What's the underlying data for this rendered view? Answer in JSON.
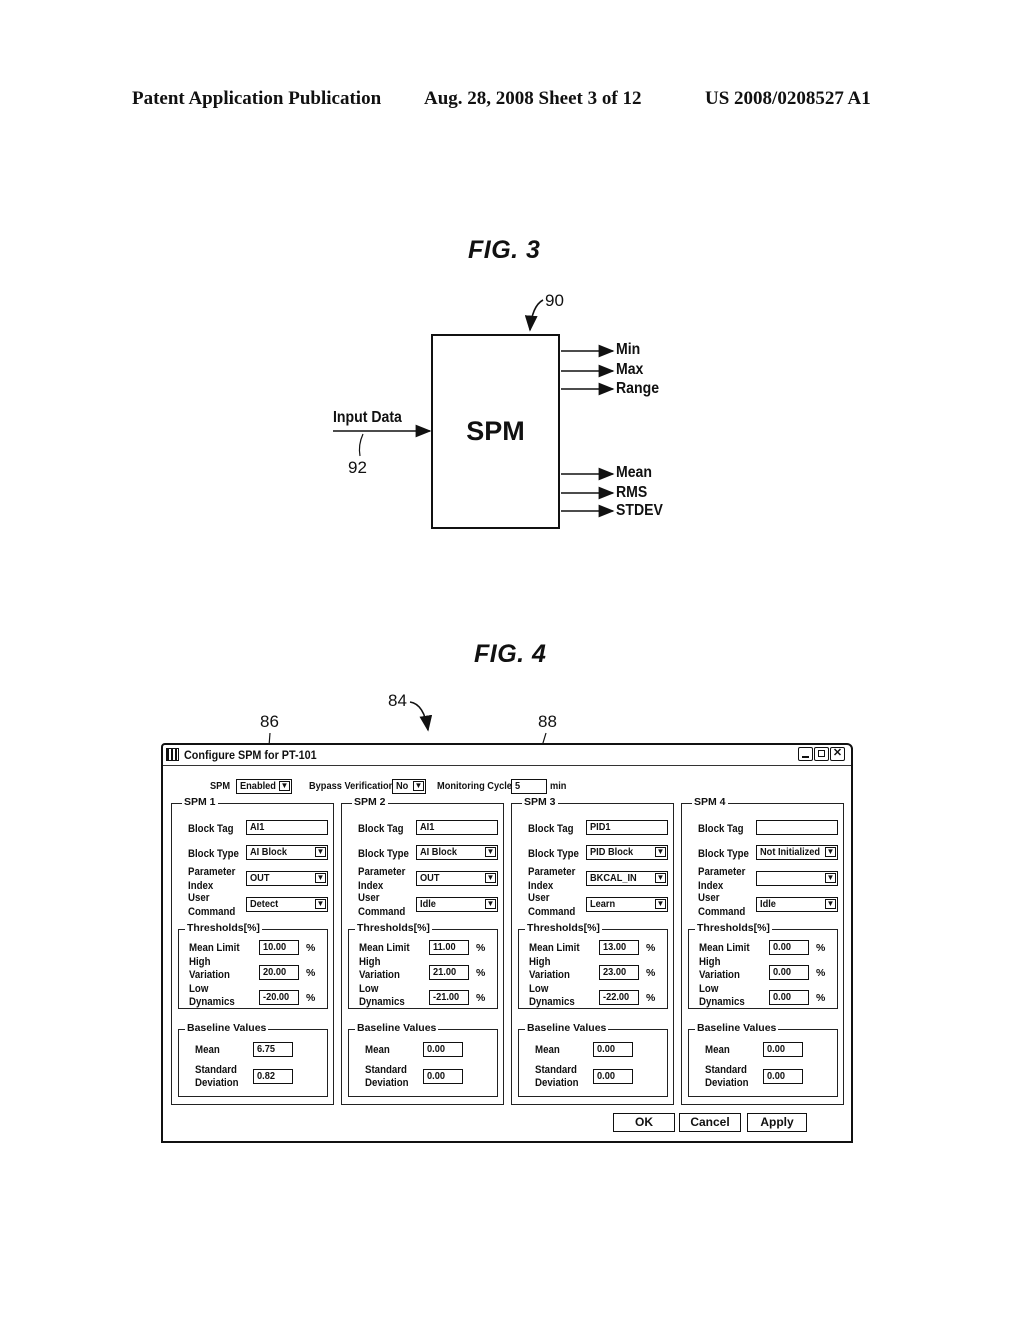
{
  "header": {
    "publication": "Patent Application Publication",
    "date_sheet": "Aug. 28, 2008  Sheet 3 of 12",
    "number": "US 2008/0208527 A1"
  },
  "fig3": {
    "title": "FIG. 3",
    "block_label": "SPM",
    "input_label": "Input Data",
    "ref_block": "90",
    "ref_input": "92",
    "outputs": [
      "Min",
      "Max",
      "Range",
      "Mean",
      "RMS",
      "STDEV"
    ]
  },
  "fig4": {
    "title": "FIG. 4",
    "ref_dialog": "84",
    "ref_spm": "86",
    "ref_cycle": "88",
    "dialog": {
      "title": "Configure SPM for PT-101",
      "icons": {
        "app": "app-icon",
        "minimize": "minimize-icon",
        "maximize": "maximize-icon",
        "close": "close-icon"
      },
      "spm_label": "SPM",
      "spm_value": "Enabled",
      "bypass_label": "Bypass Verification",
      "bypass_value": "No",
      "cycle_label": "Monitoring Cycle",
      "cycle_value": "5",
      "cycle_unit": "min",
      "labels": {
        "block_tag": "Block Tag",
        "block_type": "Block Type",
        "param1": "Parameter",
        "param2": "Index",
        "user1": "User",
        "user2": "Command",
        "thresholds": "Thresholds[%]",
        "mean_limit": "Mean Limit",
        "high1": "High",
        "high2": "Variation",
        "low1": "Low",
        "low2": "Dynamics",
        "percent": "%",
        "baseline": "Baseline Values",
        "mean": "Mean",
        "std1": "Standard",
        "std2": "Deviation"
      },
      "groups": [
        {
          "name": "SPM 1",
          "block_tag": "AI1",
          "block_type": "AI Block",
          "parameter_index": "OUT",
          "user_command": "Detect",
          "mean_limit": "10.00",
          "high_variation": "20.00",
          "low_dynamics": "-20.00",
          "baseline_mean": "6.75",
          "baseline_std": "0.82"
        },
        {
          "name": "SPM 2",
          "block_tag": "AI1",
          "block_type": "AI Block",
          "parameter_index": "OUT",
          "user_command": "Idle",
          "mean_limit": "11.00",
          "high_variation": "21.00",
          "low_dynamics": "-21.00",
          "baseline_mean": "0.00",
          "baseline_std": "0.00"
        },
        {
          "name": "SPM 3",
          "block_tag": "PID1",
          "block_type": "PID Block",
          "parameter_index": "BKCAL_IN",
          "user_command": "Learn",
          "mean_limit": "13.00",
          "high_variation": "23.00",
          "low_dynamics": "-22.00",
          "baseline_mean": "0.00",
          "baseline_std": "0.00"
        },
        {
          "name": "SPM 4",
          "block_tag": "",
          "block_type": "Not Initialized",
          "parameter_index": "",
          "user_command": "Idle",
          "mean_limit": "0.00",
          "high_variation": "0.00",
          "low_dynamics": "0.00",
          "baseline_mean": "0.00",
          "baseline_std": "0.00"
        }
      ],
      "buttons": {
        "ok": "OK",
        "cancel": "Cancel",
        "apply": "Apply"
      }
    }
  }
}
